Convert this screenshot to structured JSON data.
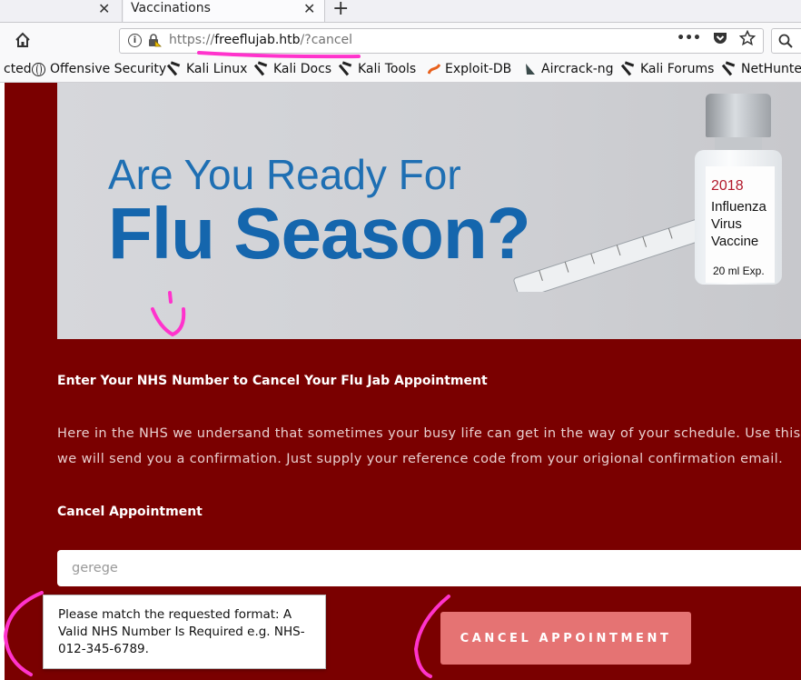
{
  "browser": {
    "tabs": [
      {
        "title": ""
      },
      {
        "title": "Vaccinations"
      }
    ],
    "tab_close_glyph": "✕",
    "new_tab_glyph": "+",
    "url": {
      "prefix": "https://",
      "host": "freeflujab.htb",
      "path": "/?cancel"
    },
    "url_actions": {
      "more": "•••"
    },
    "bookmarks": [
      {
        "label": "cted",
        "icon": "none"
      },
      {
        "label": "Offensive Security",
        "icon": "globe-icon"
      },
      {
        "label": "Kali Linux",
        "icon": "kali-icon"
      },
      {
        "label": "Kali Docs",
        "icon": "kali-icon"
      },
      {
        "label": "Kali Tools",
        "icon": "kali-icon"
      },
      {
        "label": "Exploit-DB",
        "icon": "exploit-db-icon"
      },
      {
        "label": "Aircrack-ng",
        "icon": "aircrack-icon"
      },
      {
        "label": "Kali Forums",
        "icon": "kali-icon"
      },
      {
        "label": "NetHunter",
        "icon": "kali-icon"
      }
    ]
  },
  "banner": {
    "line1": "Are You Ready For",
    "line2": "Flu Season?",
    "vial_year": "2018",
    "vial_text": "Influenza\nVirus\nVaccine",
    "vial_ml": "20 ml   Exp."
  },
  "content": {
    "section_title": "Enter Your NHS Number to Cancel Your Flu Jab Appointment",
    "desc_line1": "Here in the NHS we undersand that sometimes your busy life can get in the way of your schedule. Use this form to can",
    "desc_line2": "we will send you a confirmation. Just supply your reference code from your origional confirmation email.",
    "form_label": "Cancel Appointment",
    "input_value": "gerege",
    "tooltip": "Please match the requested format: A Valid NHS Number Is Required e.g. NHS-012-345-6789.",
    "button_label": "CANCEL APPOINTMENT"
  },
  "colors": {
    "page_bg": "#7a0000",
    "button_bg": "#e57373",
    "annotation": "#ff33cc",
    "banner_blue": "#1566ad"
  }
}
